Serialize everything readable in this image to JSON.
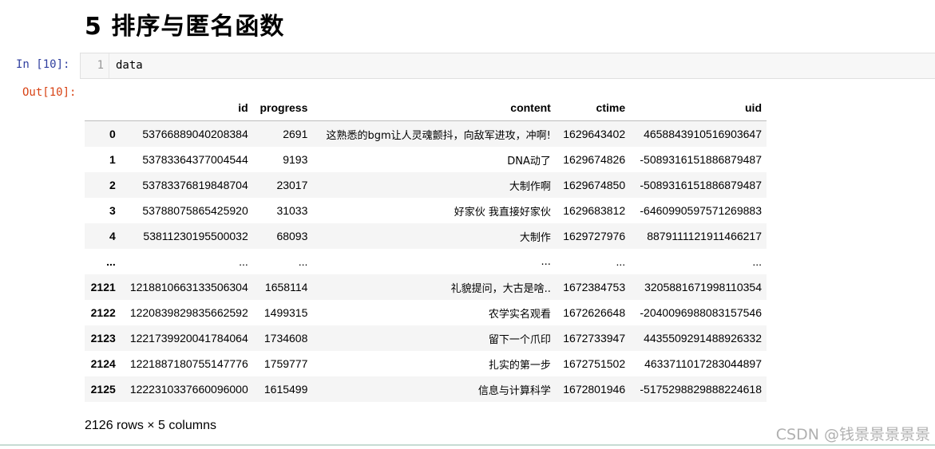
{
  "heading": "5  排序与匿名函数",
  "input_cell": {
    "prompt": "In  [10]:",
    "line_number": "1",
    "code": "data"
  },
  "output_prompt": "Out[10]:",
  "table": {
    "columns": [
      "",
      "id",
      "progress",
      "content",
      "ctime",
      "uid"
    ],
    "rows": [
      {
        "index": "0",
        "id": "53766889040208384",
        "progress": "2691",
        "content": "这熟悉的bgm让人灵魂颤抖，向敌军进攻，冲啊!",
        "ctime": "1629643402",
        "uid": "4658843910516903647"
      },
      {
        "index": "1",
        "id": "53783364377004544",
        "progress": "9193",
        "content": "DNA动了",
        "ctime": "1629674826",
        "uid": "-5089316151886879487"
      },
      {
        "index": "2",
        "id": "53783376819848704",
        "progress": "23017",
        "content": "大制作啊",
        "ctime": "1629674850",
        "uid": "-5089316151886879487"
      },
      {
        "index": "3",
        "id": "53788075865425920",
        "progress": "31033",
        "content": "好家伙 我直接好家伙",
        "ctime": "1629683812",
        "uid": "-6460990597571269883"
      },
      {
        "index": "4",
        "id": "53811230195500032",
        "progress": "68093",
        "content": "大制作",
        "ctime": "1629727976",
        "uid": "8879111121911466217"
      },
      {
        "index": "...",
        "id": "...",
        "progress": "...",
        "content": "...",
        "ctime": "...",
        "uid": "..."
      },
      {
        "index": "2121",
        "id": "1218810663133506304",
        "progress": "1658114",
        "content": "礼貌提问，大古是啥..",
        "ctime": "1672384753",
        "uid": "3205881671998110354"
      },
      {
        "index": "2122",
        "id": "1220839829835662592",
        "progress": "1499315",
        "content": "农学实名观看",
        "ctime": "1672626648",
        "uid": "-2040096988083157546"
      },
      {
        "index": "2123",
        "id": "1221739920041784064",
        "progress": "1734608",
        "content": "留下一个爪印",
        "ctime": "1672733947",
        "uid": "4435509291488926332"
      },
      {
        "index": "2124",
        "id": "1221887180755147776",
        "progress": "1759777",
        "content": "扎实的第一步",
        "ctime": "1672751502",
        "uid": "4633711017283044897"
      },
      {
        "index": "2125",
        "id": "1222310337660096000",
        "progress": "1615499",
        "content": "信息与计算科学",
        "ctime": "1672801946",
        "uid": "-5175298829888224618"
      }
    ]
  },
  "shape_text": "2126 rows × 5 columns",
  "watermark": "CSDN @钱景景景景景"
}
